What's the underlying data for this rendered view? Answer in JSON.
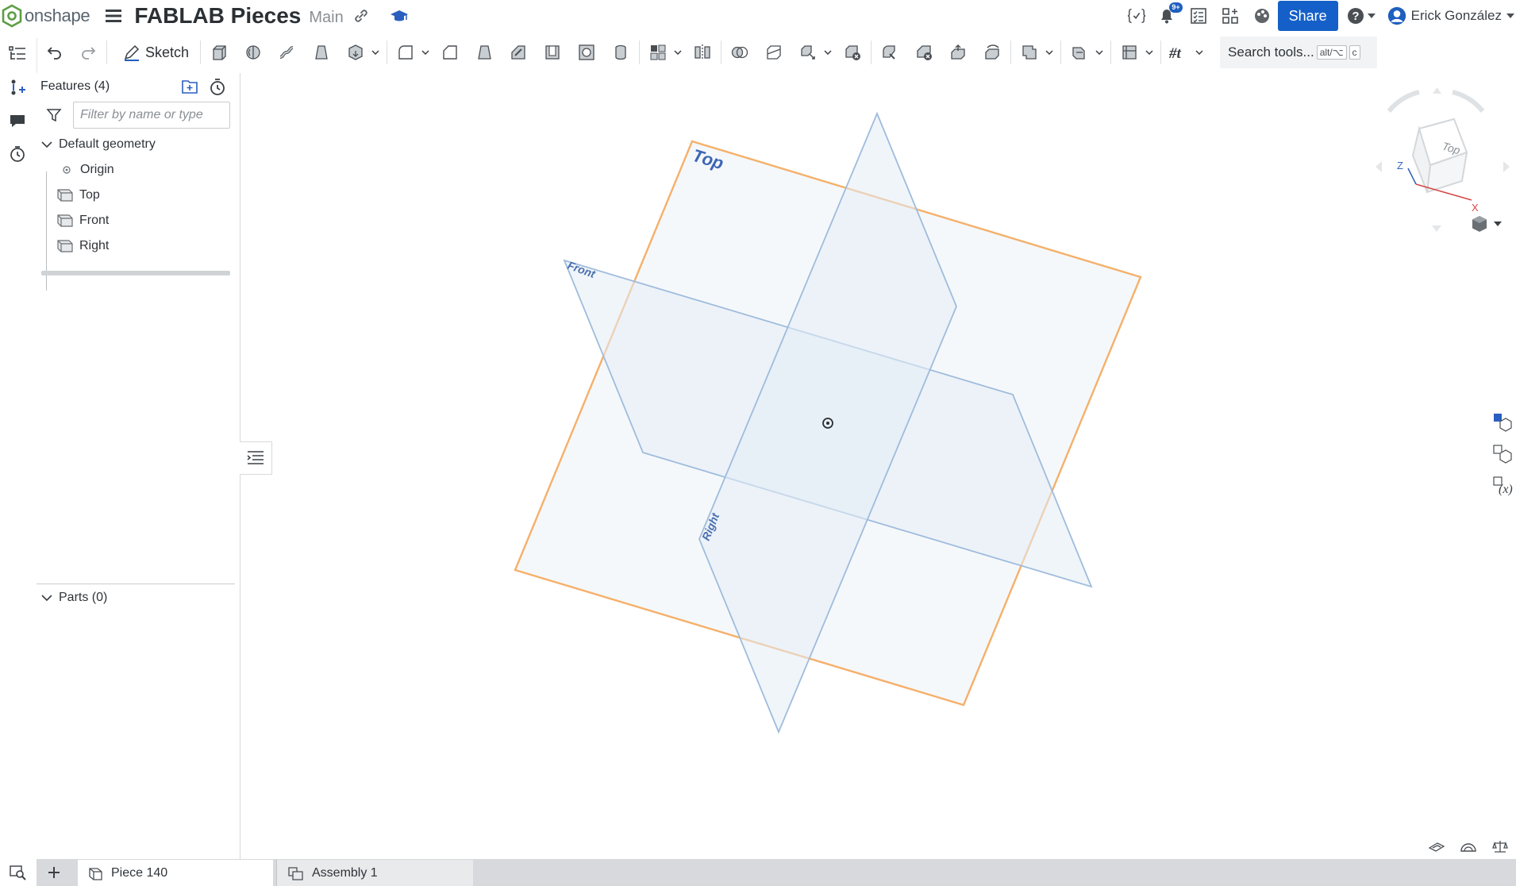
{
  "app": {
    "logo_text": "onshape"
  },
  "document": {
    "title": "FABLAB Pieces",
    "branch": "Main"
  },
  "header": {
    "share_label": "Share",
    "notification_count": "9+",
    "user_name": "Erick González"
  },
  "toolbar": {
    "sketch_label": "Sketch",
    "search_tools_label": "Search tools...",
    "search_shortcut_1": "alt/⌥",
    "search_shortcut_2": "c"
  },
  "feature_panel": {
    "title": "Features (4)",
    "filter_placeholder": "Filter by name or type",
    "default_geometry_label": "Default geometry",
    "items": [
      {
        "label": "Origin",
        "icon": "origin-icon"
      },
      {
        "label": "Top",
        "icon": "plane-icon"
      },
      {
        "label": "Front",
        "icon": "plane-icon"
      },
      {
        "label": "Right",
        "icon": "plane-icon"
      }
    ],
    "parts_label": "Parts (0)"
  },
  "viewport": {
    "plane_labels": {
      "top": "Top",
      "front": "Front",
      "right": "Right"
    },
    "viewcube_face": "Top",
    "axis_x": "X",
    "axis_z": "Z",
    "colors": {
      "top_plane_edge": "#f5b06a",
      "plane_edge": "#9fbcdc",
      "plane_fill": "#e9eff7",
      "plane_label": "#3d66b4"
    }
  },
  "tabs": [
    {
      "label": "Piece 140",
      "active": true
    },
    {
      "label": "Assembly 1",
      "active": false
    }
  ],
  "colors": {
    "accent": "#1560c8",
    "tab_bar": "#d7d9dc"
  }
}
